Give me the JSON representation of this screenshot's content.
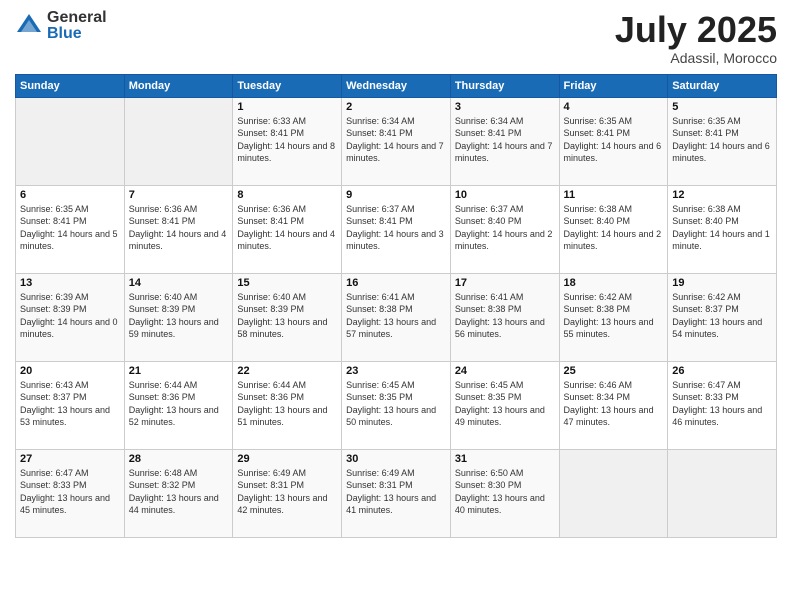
{
  "logo": {
    "general": "General",
    "blue": "Blue"
  },
  "title": "July 2025",
  "subtitle": "Adassil, Morocco",
  "weekdays": [
    "Sunday",
    "Monday",
    "Tuesday",
    "Wednesday",
    "Thursday",
    "Friday",
    "Saturday"
  ],
  "weeks": [
    [
      {
        "day": "",
        "info": ""
      },
      {
        "day": "",
        "info": ""
      },
      {
        "day": "1",
        "info": "Sunrise: 6:33 AM\nSunset: 8:41 PM\nDaylight: 14 hours and 8 minutes."
      },
      {
        "day": "2",
        "info": "Sunrise: 6:34 AM\nSunset: 8:41 PM\nDaylight: 14 hours and 7 minutes."
      },
      {
        "day": "3",
        "info": "Sunrise: 6:34 AM\nSunset: 8:41 PM\nDaylight: 14 hours and 7 minutes."
      },
      {
        "day": "4",
        "info": "Sunrise: 6:35 AM\nSunset: 8:41 PM\nDaylight: 14 hours and 6 minutes."
      },
      {
        "day": "5",
        "info": "Sunrise: 6:35 AM\nSunset: 8:41 PM\nDaylight: 14 hours and 6 minutes."
      }
    ],
    [
      {
        "day": "6",
        "info": "Sunrise: 6:35 AM\nSunset: 8:41 PM\nDaylight: 14 hours and 5 minutes."
      },
      {
        "day": "7",
        "info": "Sunrise: 6:36 AM\nSunset: 8:41 PM\nDaylight: 14 hours and 4 minutes."
      },
      {
        "day": "8",
        "info": "Sunrise: 6:36 AM\nSunset: 8:41 PM\nDaylight: 14 hours and 4 minutes."
      },
      {
        "day": "9",
        "info": "Sunrise: 6:37 AM\nSunset: 8:41 PM\nDaylight: 14 hours and 3 minutes."
      },
      {
        "day": "10",
        "info": "Sunrise: 6:37 AM\nSunset: 8:40 PM\nDaylight: 14 hours and 2 minutes."
      },
      {
        "day": "11",
        "info": "Sunrise: 6:38 AM\nSunset: 8:40 PM\nDaylight: 14 hours and 2 minutes."
      },
      {
        "day": "12",
        "info": "Sunrise: 6:38 AM\nSunset: 8:40 PM\nDaylight: 14 hours and 1 minute."
      }
    ],
    [
      {
        "day": "13",
        "info": "Sunrise: 6:39 AM\nSunset: 8:39 PM\nDaylight: 14 hours and 0 minutes."
      },
      {
        "day": "14",
        "info": "Sunrise: 6:40 AM\nSunset: 8:39 PM\nDaylight: 13 hours and 59 minutes."
      },
      {
        "day": "15",
        "info": "Sunrise: 6:40 AM\nSunset: 8:39 PM\nDaylight: 13 hours and 58 minutes."
      },
      {
        "day": "16",
        "info": "Sunrise: 6:41 AM\nSunset: 8:38 PM\nDaylight: 13 hours and 57 minutes."
      },
      {
        "day": "17",
        "info": "Sunrise: 6:41 AM\nSunset: 8:38 PM\nDaylight: 13 hours and 56 minutes."
      },
      {
        "day": "18",
        "info": "Sunrise: 6:42 AM\nSunset: 8:38 PM\nDaylight: 13 hours and 55 minutes."
      },
      {
        "day": "19",
        "info": "Sunrise: 6:42 AM\nSunset: 8:37 PM\nDaylight: 13 hours and 54 minutes."
      }
    ],
    [
      {
        "day": "20",
        "info": "Sunrise: 6:43 AM\nSunset: 8:37 PM\nDaylight: 13 hours and 53 minutes."
      },
      {
        "day": "21",
        "info": "Sunrise: 6:44 AM\nSunset: 8:36 PM\nDaylight: 13 hours and 52 minutes."
      },
      {
        "day": "22",
        "info": "Sunrise: 6:44 AM\nSunset: 8:36 PM\nDaylight: 13 hours and 51 minutes."
      },
      {
        "day": "23",
        "info": "Sunrise: 6:45 AM\nSunset: 8:35 PM\nDaylight: 13 hours and 50 minutes."
      },
      {
        "day": "24",
        "info": "Sunrise: 6:45 AM\nSunset: 8:35 PM\nDaylight: 13 hours and 49 minutes."
      },
      {
        "day": "25",
        "info": "Sunrise: 6:46 AM\nSunset: 8:34 PM\nDaylight: 13 hours and 47 minutes."
      },
      {
        "day": "26",
        "info": "Sunrise: 6:47 AM\nSunset: 8:33 PM\nDaylight: 13 hours and 46 minutes."
      }
    ],
    [
      {
        "day": "27",
        "info": "Sunrise: 6:47 AM\nSunset: 8:33 PM\nDaylight: 13 hours and 45 minutes."
      },
      {
        "day": "28",
        "info": "Sunrise: 6:48 AM\nSunset: 8:32 PM\nDaylight: 13 hours and 44 minutes."
      },
      {
        "day": "29",
        "info": "Sunrise: 6:49 AM\nSunset: 8:31 PM\nDaylight: 13 hours and 42 minutes."
      },
      {
        "day": "30",
        "info": "Sunrise: 6:49 AM\nSunset: 8:31 PM\nDaylight: 13 hours and 41 minutes."
      },
      {
        "day": "31",
        "info": "Sunrise: 6:50 AM\nSunset: 8:30 PM\nDaylight: 13 hours and 40 minutes."
      },
      {
        "day": "",
        "info": ""
      },
      {
        "day": "",
        "info": ""
      }
    ]
  ]
}
